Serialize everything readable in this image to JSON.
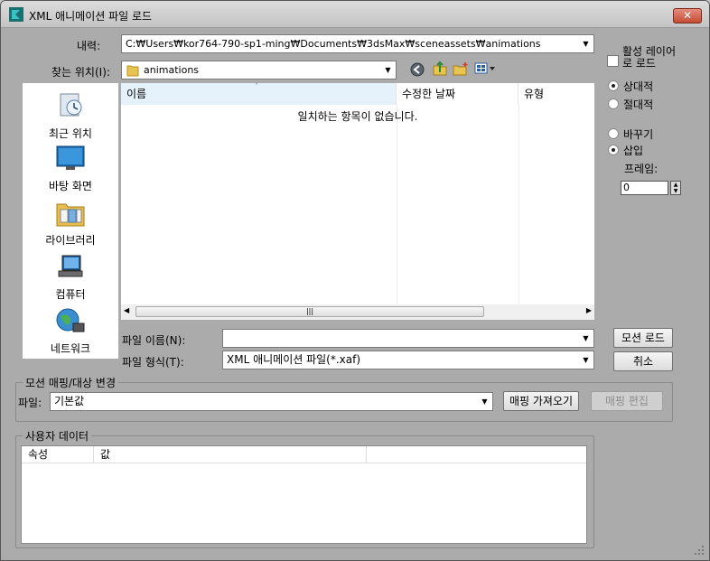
{
  "window": {
    "title": "XML 애니메이션 파일 로드",
    "close_glyph": "✕"
  },
  "history": {
    "label": "내력:",
    "value": "C:₩Users₩kor764-790-sp1-ming₩Documents₩3dsMax₩sceneassets₩animations"
  },
  "lookin": {
    "label": "찾는 위치(I):",
    "value": "animations"
  },
  "places": [
    {
      "label": "최근 위치",
      "icon": "recent-places-icon"
    },
    {
      "label": "바탕 화면",
      "icon": "desktop-icon"
    },
    {
      "label": "라이브러리",
      "icon": "libraries-icon"
    },
    {
      "label": "컴퓨터",
      "icon": "computer-icon"
    },
    {
      "label": "네트워크",
      "icon": "network-icon"
    }
  ],
  "filelist": {
    "columns": [
      "이름",
      "수정한 날짜",
      "유형"
    ],
    "empty_message": "일치하는 항목이 없습니다."
  },
  "filename": {
    "label": "파일 이름(N):",
    "value": ""
  },
  "filetype": {
    "label": "파일 형식(T):",
    "value": "XML 애니메이션 파일(*.xaf)"
  },
  "buttons": {
    "load_motion": "모션 로드",
    "cancel": "취소"
  },
  "options": {
    "load_active_layer": "활성 레이어\n로 로드",
    "relative": "상대적",
    "absolute": "절대적",
    "replace": "바꾸기",
    "insert": "삽입",
    "frame_label": "프레임:",
    "frame_value": "0",
    "selected_coord": "relative",
    "selected_mode": "insert"
  },
  "mapping": {
    "group_title": "모션 매핑/대상 변경",
    "file_label": "파일:",
    "file_value": "기본값",
    "get_mapping": "매핑 가져오기",
    "edit_mapping": "매핑 편집"
  },
  "user_data": {
    "group_title": "사용자 데이터",
    "columns": [
      "속성",
      "값"
    ]
  },
  "colors": {
    "dialog_bg": "#ababab",
    "accent": "#1e8fd0",
    "close": "#c44d35"
  }
}
